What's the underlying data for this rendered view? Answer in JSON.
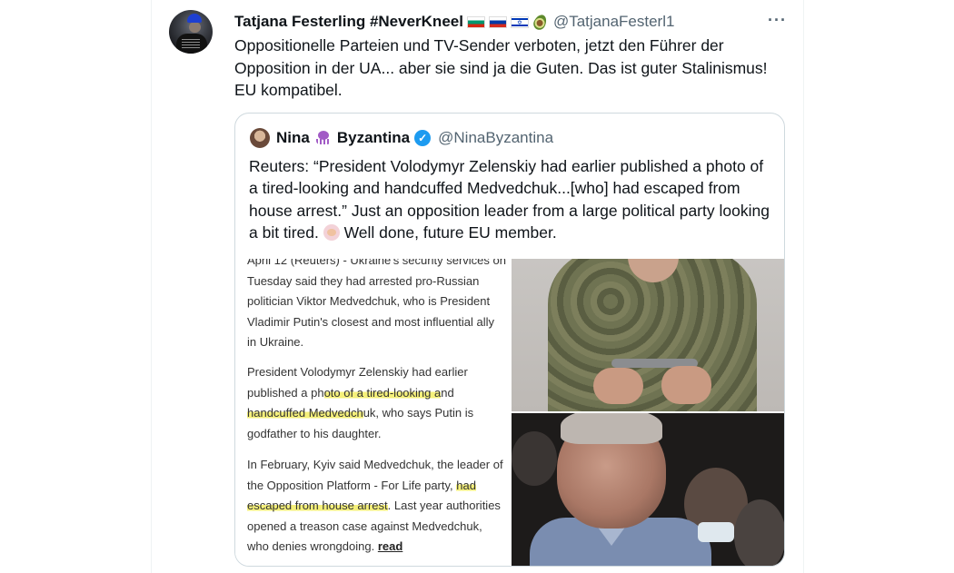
{
  "tweet": {
    "author_name": "Tatjana Festerling #NeverKneel",
    "author_flags": [
      "bulgaria-flag-icon",
      "russia-flag-icon",
      "israel-flag-icon",
      "avocado-icon"
    ],
    "author_handle": "@TatjanaFesterl1",
    "more_label": "···",
    "text": "Oppositionelle Parteien und TV-Sender verboten, jetzt den Führer der Opposition in der UA... aber sie sind ja die Guten. Das ist guter Stalinismus! EU kompatibel."
  },
  "quote": {
    "author_name_part1": "Nina",
    "author_name_part2": "Byzantina",
    "author_handle": "@NinaByzantina",
    "verified_mark": "✓",
    "text_before_emoji": "Reuters: “President Volodymyr Zelenskiy had earlier published a photo of a tired-looking and handcuffed Medvedchuk...[who] had escaped from house arrest.” Just an opposition leader from a large political party looking a bit tired.",
    "text_after_emoji": "Well done, future EU member."
  },
  "article": {
    "p1": "April 12 (Reuters) - Ukraine's security services on Tuesday said they had arrested pro-Russian politician Viktor Medvedchuk, who is President Vladimir Putin's closest and most influential ally in Ukraine.",
    "p2_a": "President Volodymyr Zelenskiy had earlier published a ph",
    "p2_hl": "oto of a tired-looking a",
    "p2_b": "nd",
    "p2_hl2": "handcuffed Medvedch",
    "p2_c": "uk, who says Putin is godfather to his daughter.",
    "p3_a": "In February, Kyiv said Medvedchuk, the leader of the Opposition Platform - For Life party,",
    "p3_hl": "had escaped from house arrest",
    "p3_b": ". Last year authorities opened a treason case against Medvedchuk, who denies wrongdoing.",
    "read_more": "read"
  },
  "colors": {
    "text": "#0f1419",
    "secondary": "#536471",
    "border": "#cfd9de",
    "verified": "#1d9bf0",
    "highlight": "#f5f07a"
  }
}
